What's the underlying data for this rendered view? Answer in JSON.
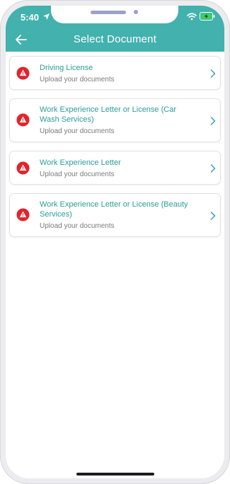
{
  "status_bar": {
    "time": "5:40",
    "location_icon": "location-arrow-icon",
    "wifi_icon": "wifi-icon",
    "battery_icon": "battery-charging-icon"
  },
  "header": {
    "title": "Select Document",
    "back_icon": "back-arrow-icon",
    "color": "#43b1ad"
  },
  "documents": [
    {
      "title": "Driving License",
      "subtitle": "Upload your documents",
      "status_icon": "warning-icon",
      "status_color": "#e0252d"
    },
    {
      "title": "Work Experience Letter or License (Car Wash Services)",
      "subtitle": "Upload your documents",
      "status_icon": "warning-icon",
      "status_color": "#e0252d"
    },
    {
      "title": "Work Experience Letter",
      "subtitle": "Upload your documents",
      "status_icon": "warning-icon",
      "status_color": "#e0252d"
    },
    {
      "title": "Work Experience Letter or License (Beauty Services)",
      "subtitle": "Upload your documents",
      "status_icon": "warning-icon",
      "status_color": "#e0252d"
    }
  ],
  "colors": {
    "accent": "#43b1ad",
    "title_text": "#2b9d98",
    "subtitle_text": "#7a7a7a",
    "warning": "#e0252d"
  }
}
